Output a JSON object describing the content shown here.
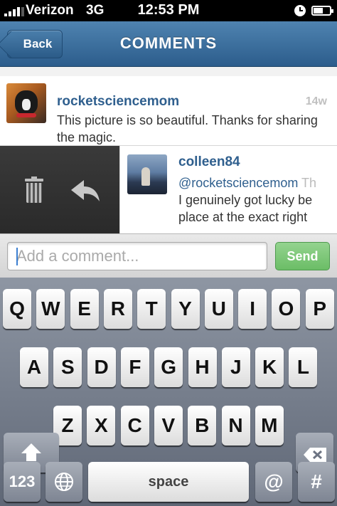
{
  "status_bar": {
    "carrier": "Verizon",
    "network": "3G",
    "time": "12:53 PM",
    "battery_level": 0.6,
    "icons": [
      "signal-icon",
      "clock-icon",
      "battery-icon"
    ]
  },
  "nav": {
    "back_label": "Back",
    "title": "COMMENTS"
  },
  "comments": [
    {
      "username": "rocketsciencemom",
      "timestamp": "14w",
      "text": "This picture is so beautiful. Thanks for sharing the magic."
    },
    {
      "username": "colleen84",
      "mention": "@rocketsciencemom",
      "line1_rest": " Th",
      "line2": "I genuinely got lucky be",
      "line3": "place at the exact right"
    }
  ],
  "swipe_actions": {
    "icons": [
      "trash-icon",
      "reply-icon"
    ]
  },
  "input": {
    "placeholder": "Add a comment...",
    "value": "",
    "send_label": "Send"
  },
  "keyboard": {
    "row1": [
      "Q",
      "W",
      "E",
      "R",
      "T",
      "Y",
      "U",
      "I",
      "O",
      "P"
    ],
    "row2": [
      "A",
      "S",
      "D",
      "F",
      "G",
      "H",
      "J",
      "K",
      "L"
    ],
    "row3": [
      "Z",
      "X",
      "C",
      "V",
      "B",
      "N",
      "M"
    ],
    "numbers_label": "123",
    "space_label": "space",
    "at_label": "@",
    "hash_label": "#"
  },
  "colors": {
    "nav_blue": "#3d6e9c",
    "username_blue": "#2f5f8e",
    "send_green": "#7cc677"
  }
}
